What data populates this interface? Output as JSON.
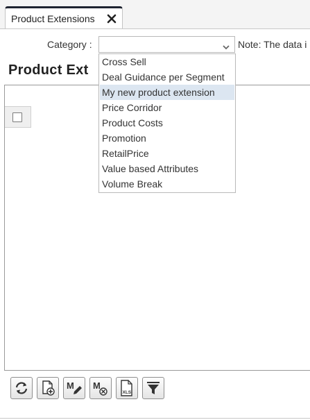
{
  "tabs": [
    {
      "label": "Product Extensions",
      "active": true
    }
  ],
  "filter": {
    "category_label": "Category :",
    "category_value": "",
    "note": "Note: The data i"
  },
  "page_title": "Product Ext",
  "dropdown": {
    "options": [
      "Cross Sell",
      "Deal Guidance per Segment",
      "My new product extension",
      "Price Corridor",
      "Product Costs",
      "Promotion",
      "RetailPrice",
      "Value based Attributes",
      "Volume Break"
    ],
    "highlighted": "My new product extension"
  },
  "toolbar": {
    "buttons": [
      {
        "icon": "refresh-icon"
      },
      {
        "icon": "add-document-icon"
      },
      {
        "icon": "mass-edit-icon"
      },
      {
        "icon": "mass-delete-icon"
      },
      {
        "icon": "export-xls-icon",
        "label": "XLS"
      },
      {
        "icon": "filter-icon"
      }
    ]
  },
  "colors": {
    "tab_top_border": "#1e2330",
    "highlight": "#dce6f1",
    "border": "#b9b9b9"
  }
}
